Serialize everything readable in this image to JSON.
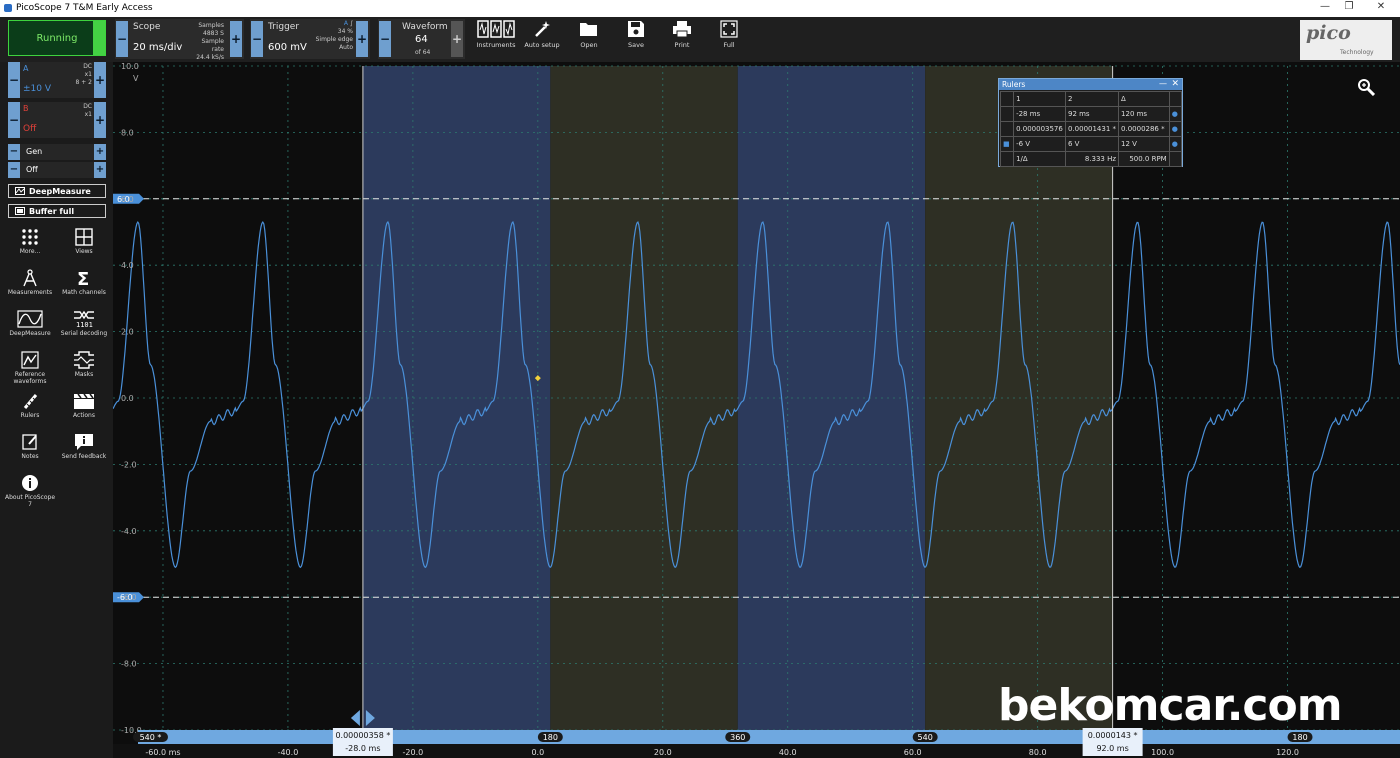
{
  "window": {
    "title": "PicoScope 7 T&M Early Access"
  },
  "run_state": "Running",
  "toolbar": {
    "scope": {
      "label": "Scope",
      "value": "20 ms/div",
      "samples_label": "Samples",
      "samples": "4883 S",
      "rate_label": "Sample rate",
      "rate": "24.4 kS/s"
    },
    "trigger": {
      "label": "Trigger",
      "value": "600 mV",
      "channel": "A",
      "percent": "34 %",
      "type": "Simple edge",
      "mode": "Auto"
    },
    "waveform": {
      "label": "Waveform",
      "value": "64",
      "of": "of 64"
    },
    "buttons": [
      {
        "label": "Instruments",
        "icon": "instruments-icon"
      },
      {
        "label": "Auto setup",
        "icon": "magic-wand-icon"
      },
      {
        "label": "Open",
        "icon": "folder-icon"
      },
      {
        "label": "Save",
        "icon": "save-icon"
      },
      {
        "label": "Print",
        "icon": "printer-icon"
      },
      {
        "label": "Full",
        "icon": "fullscreen-icon"
      }
    ],
    "logo": {
      "text": "pico",
      "sub": "Technology"
    }
  },
  "channels": [
    {
      "name": "A",
      "range": "±10 V",
      "coupling": "DC",
      "probe": "x1",
      "res": "8 + 2",
      "color": "#4a90d9"
    },
    {
      "name": "B",
      "range": "Off",
      "coupling": "DC",
      "probe": "x1",
      "color": "#e0413a"
    }
  ],
  "generator": {
    "label": "Gen",
    "state": "Off"
  },
  "sidebar_buttons": {
    "deepmeasure": "DeepMeasure",
    "buffer": "Buffer full"
  },
  "tools": [
    {
      "label": "More...",
      "icon": "dots-grid-icon"
    },
    {
      "label": "Views",
      "icon": "views-grid-icon"
    },
    {
      "label": "Measurements",
      "icon": "compass-icon"
    },
    {
      "label": "Math channels",
      "icon": "sigma-icon"
    },
    {
      "label": "DeepMeasure",
      "icon": "deepmeasure-icon"
    },
    {
      "label": "Serial decoding",
      "icon": "serial-decoding-icon"
    },
    {
      "label": "Reference waveforms",
      "icon": "reference-waveform-icon"
    },
    {
      "label": "Masks",
      "icon": "mask-icon"
    },
    {
      "label": "Rulers",
      "icon": "ruler-icon"
    },
    {
      "label": "Actions",
      "icon": "clapper-icon"
    },
    {
      "label": "Notes",
      "icon": "notes-icon"
    },
    {
      "label": "Send feedback",
      "icon": "feedback-icon"
    },
    {
      "label": "About PicoScope 7",
      "icon": "info-icon"
    }
  ],
  "rulers": {
    "title": "Rulers",
    "rows": [
      [
        "",
        "1",
        "2",
        "Δ"
      ],
      [
        "",
        "-28 ms",
        "92 ms",
        "120 ms"
      ],
      [
        "",
        "0.000003576",
        "0.00001431 *",
        "0.0000286 *"
      ],
      [
        "",
        "-6 V",
        "6 V",
        "12 V"
      ],
      [
        "",
        "1/Δ",
        "8.333 Hz",
        "500.0 RPM"
      ]
    ]
  },
  "markers": {
    "y_ruler1": "6.0",
    "y_ruler2": "-6.0",
    "t_ruler1": "0.00000358 *",
    "t_ruler1_time": "-28.0 ms",
    "t_ruler2": "0.0000143 *",
    "t_ruler2_time": "92.0 ms",
    "phase_labels": [
      "540 *",
      "180",
      "360",
      "540",
      "180"
    ]
  },
  "watermark": "bekomcar.com",
  "chart_data": {
    "type": "line",
    "y_unit": "V",
    "y_ticks": [
      "10.0",
      "8.0",
      "6.0",
      "4.0",
      "2.0",
      "0.0",
      "-2.0",
      "-4.0",
      "-6.0",
      "-8.0",
      "-10.0"
    ],
    "ylim": [
      -10,
      10
    ],
    "x_ticks": [
      "-60.0 ms",
      "-40.0",
      "-20.0",
      "0.0",
      "20.0",
      "40.0",
      "60.0",
      "80.0",
      "100.0",
      "120.0"
    ],
    "xlim": [
      -68,
      138
    ],
    "grid": true,
    "series": [
      {
        "color": "#4a90d9",
        "period_ms": 20,
        "first_peak_ms": -64,
        "peak_v": 5.3,
        "trough_v": -5.1,
        "plateau_v": -0.4
      }
    ],
    "trigger_point": {
      "x": 0,
      "y": 0.6
    },
    "phase_bands": [
      {
        "from": -28,
        "to": 2,
        "color": "#2c3a5c"
      },
      {
        "from": 2,
        "to": 32,
        "color": "#2e2f24"
      },
      {
        "from": 32,
        "to": 62,
        "color": "#2c3a5c"
      },
      {
        "from": 62,
        "to": 92,
        "color": "#2e2f24"
      }
    ]
  }
}
